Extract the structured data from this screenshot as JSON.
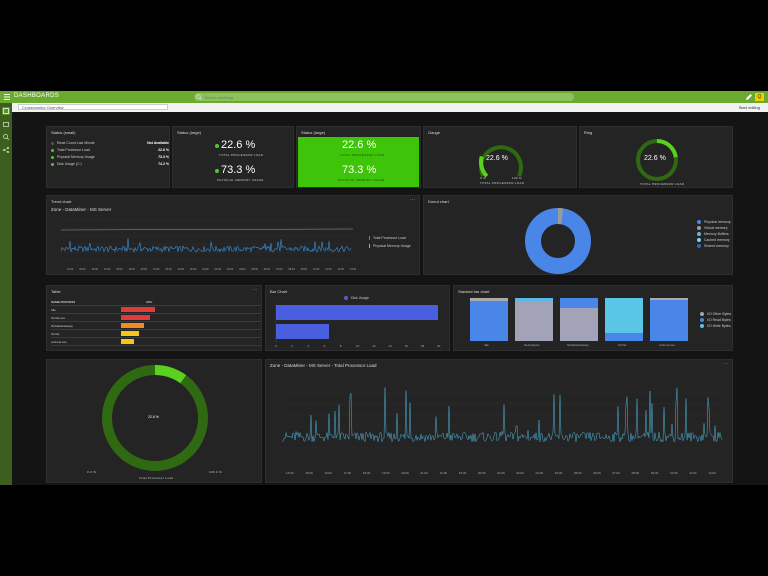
{
  "app": {
    "brand": "DASHBOARDS",
    "search_placeholder": "Search anything",
    "breadcrumb": "Crossmonitor Overview",
    "edit_label": "Start editing",
    "avatar": "Q"
  },
  "tiles": {
    "status_small": {
      "title": "Status (small)",
      "rows": [
        {
          "label": "Read Count Last Minute",
          "value": "Not Available"
        },
        {
          "label": "Total Processor Load",
          "value": "22.6 %"
        },
        {
          "label": "Physical Memory Usage",
          "value": "73.3 %"
        },
        {
          "label": "Disk Usage (C:)",
          "value": "74.2 %"
        }
      ]
    },
    "status_large": {
      "title": "Status (large)",
      "v1": "22.6 %",
      "c1": "TOTAL PROCESSOR LOAD",
      "v2": "73.3 %",
      "c2": "PHYSICAL MEMORY USAGE"
    },
    "status_large_green": {
      "title": "Status (large)",
      "v1": "22.6 %",
      "c1": "TOTAL PROCESSOR LOAD",
      "v2": "73.3 %",
      "c2": "PHYSICAL MEMORY USAGE"
    },
    "gauge": {
      "title": "Gauge",
      "value": "22.6 %",
      "fraction": 0.226,
      "min": "0 %",
      "max": "100 %",
      "caption": "TOTAL PROCESSOR LOAD"
    },
    "ring": {
      "title": "Ring",
      "value": "22.6 %",
      "fraction": 0.226,
      "caption": "TOTAL PROCESSOR LOAD"
    },
    "trend": {
      "title": "Trend chart",
      "subtitle": "Zone - DataMiner - MS Server",
      "legend": [
        "Total Processor Load",
        "Physical Memory Usage"
      ],
      "ticks": [
        "14:00",
        "15:00",
        "16:00",
        "17:00",
        "18:00",
        "19:00",
        "20:00",
        "21:00",
        "22:00",
        "23:00",
        "00:00",
        "01:00",
        "02:00",
        "03:00",
        "04:00",
        "05:00",
        "06:00",
        "07:00",
        "08:00",
        "09:00",
        "10:00",
        "11:00",
        "12:00",
        "13:00"
      ]
    },
    "donut": {
      "title": "Donut chart",
      "legend": [
        "Physical memory",
        "Virtual memory",
        "Memory Buffers",
        "Cached memory",
        "Shared memory"
      ]
    },
    "table": {
      "title": "Table",
      "header_name": "NAME PROCESS",
      "header_value": "CPU",
      "rows": [
        {
          "name": "Idle",
          "value": 0.85,
          "color": "#e03a3a"
        },
        {
          "name": "SLNet.exe",
          "value": 0.72,
          "color": "#e03a3a"
        },
        {
          "name": "SLDataGateway",
          "value": 0.58,
          "color": "#f08a24"
        },
        {
          "name": "SLNet",
          "value": 0.45,
          "color": "#f5c518"
        },
        {
          "name": "svchost.exe",
          "value": 0.33,
          "color": "#f5c518"
        }
      ]
    },
    "bar": {
      "title": "Bar Chart",
      "legend": "Disk Usage",
      "ticks": [
        "0",
        "2",
        "4",
        "6",
        "8",
        "10",
        "12",
        "14",
        "16",
        "18",
        "20"
      ]
    },
    "stacked": {
      "title": "Stacked bar chart",
      "legend": [
        "I/O Other Bytes",
        "I/O Read Bytes",
        "I/O Write Bytes"
      ],
      "categories": [
        "Idle",
        "SLAnalytics",
        "SLDataGateway",
        "SLNet",
        "svchost.exe"
      ]
    },
    "big_ring": {
      "value": "22.6 %",
      "min": "0.0 %",
      "max": "100.0 %",
      "caption": "Total Processor Load"
    },
    "line_big": {
      "subtitle": "Zone - DataMiner - MS Server - Total Processor Load",
      "ticks": [
        "14:00",
        "15:00",
        "16:00",
        "17:00",
        "18:00",
        "19:00",
        "20:00",
        "21:00",
        "22:00",
        "23:00",
        "00:00",
        "01:00",
        "02:00",
        "03:00",
        "04:00",
        "05:00",
        "06:00",
        "07:00",
        "08:00",
        "09:00",
        "10:00",
        "11:00",
        "12:00"
      ]
    }
  },
  "colors": {
    "accent": "#6aab2f",
    "ok": "#4cc82a",
    "blue": "#4a7ff0",
    "line": "#4fb3d9"
  }
}
